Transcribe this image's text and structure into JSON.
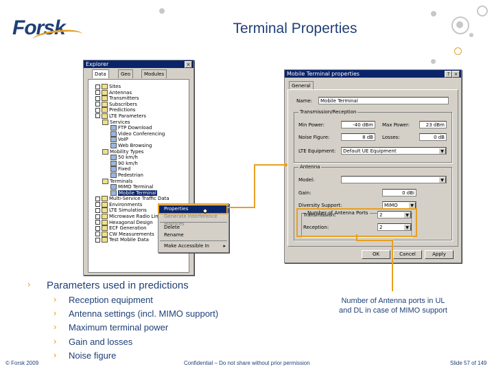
{
  "header": {
    "logo": "Forsk",
    "title": "Terminal Properties"
  },
  "explorer": {
    "title": "Explorer",
    "tabs": [
      "Data",
      "Geo",
      "Modules"
    ],
    "tree": [
      "Sites",
      "Antennas",
      "Transmitters",
      "Subscribers",
      "Predictions",
      "LTE Parameters",
      "Services",
      "FTP Download",
      "Video Conferencing",
      "VoIP",
      "Web Browsing",
      "Mobility Types",
      "50 km/h",
      "90 km/h",
      "Fixed",
      "Pedestrian",
      "Terminals",
      "MIMO Terminal",
      "Mobile Terminal",
      "Multi-Service Traffic Data",
      "Environments",
      "LTE Simulations",
      "Microwave Radio Links",
      "Hexagonal Design",
      "ECF Generation",
      "CW Measurements",
      "Test Mobile Data"
    ]
  },
  "context_menu": {
    "items": [
      "Properties",
      "Generate Interference Matrices",
      "Delete",
      "Rename",
      "Make Accessible In"
    ]
  },
  "mobile_props": {
    "title": "Mobile Terminal properties",
    "tab": "General",
    "name_label": "Name:",
    "name_value": "Mobile Terminal",
    "tx_group": "Transmission/Reception",
    "min_power_label": "Min Power:",
    "min_power_value": "-40 dBm",
    "max_power_label": "Max Power:",
    "max_power_value": "23 dBm",
    "noise_label": "Noise Figure:",
    "noise_value": "8 dB",
    "losses_label": "Losses:",
    "losses_value": "0 dB",
    "equip_label": "LTE Equipment:",
    "equip_value": "Default UE Equipment",
    "antenna_group": "Antenna",
    "model_label": "Model:",
    "model_value": "",
    "gain_label": "Gain:",
    "gain_value": "0 dBi",
    "diversity_label": "Diversity Support:",
    "diversity_value": "MIMO",
    "ports_group": "Number of Antenna Ports",
    "tx_label": "Transmission:",
    "tx_value": "2",
    "rx_label": "Reception:",
    "rx_value": "2",
    "buttons": [
      "OK",
      "Cancel",
      "Apply"
    ]
  },
  "bullets": {
    "main": "Parameters used in predictions",
    "sub": [
      "Reception equipment",
      "Antenna settings (incl. MIMO support)",
      "Maximum terminal power",
      "Gain and losses",
      "Noise figure"
    ]
  },
  "annotation": "Number of Antenna ports in UL and DL in case of MIMO support",
  "footer": {
    "copyright": "© Forsk 2009",
    "confidential": "Confidential – Do not share without prior permission",
    "slide": "Slide 57 of 149"
  },
  "colors": {
    "brand_blue": "#1f3f77",
    "accent_orange": "#e6a021",
    "titlebar": "#0a246a"
  }
}
